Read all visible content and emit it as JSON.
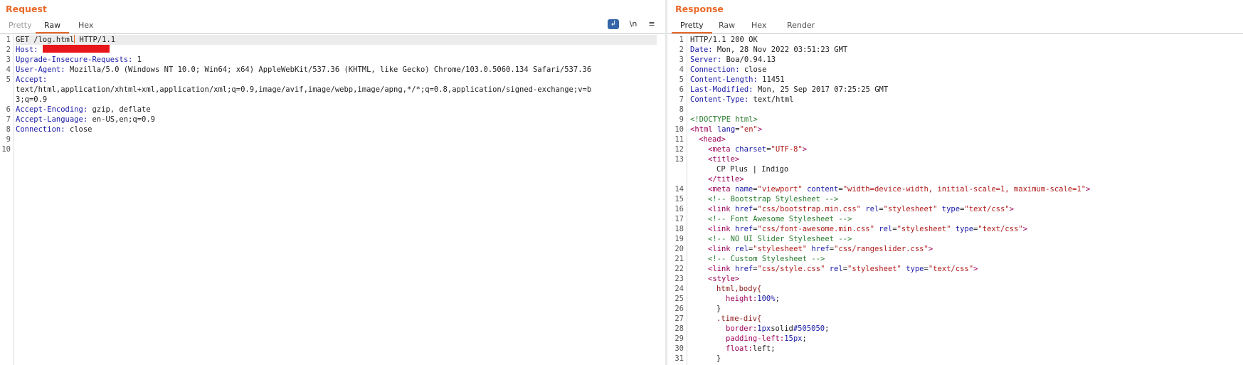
{
  "request": {
    "title": "Request",
    "tabs": [
      "Pretty",
      "Raw",
      "Hex"
    ],
    "active_tab": "Raw",
    "toolbar": {
      "wrap_icon": "wrap-lines-icon",
      "newline_label": "\\n",
      "menu_label": "≡"
    },
    "line_numbers": [
      "1",
      "2",
      "3",
      "4",
      "5",
      "",
      "",
      "6",
      "7",
      "8",
      "9",
      "10"
    ],
    "lines": {
      "l1_a": "GET /log.html",
      "l1_b": " HTTP/1.1",
      "l2_key": "Host:",
      "l3_key": "Upgrade-Insecure-Requests:",
      "l3_val": " 1",
      "l4_key": "User-Agent:",
      "l4_val": " Mozilla/5.0 (Windows NT 10.0; Win64; x64) AppleWebKit/537.36 (KHTML, like Gecko) Chrome/103.0.5060.134 Safari/537.36",
      "l5_key": "Accept:",
      "l5_val1": "text/html,application/xhtml+xml,application/xml;q=0.9,image/avif,image/webp,image/apng,*/*;q=0.8,application/signed-exchange;v=b",
      "l5_val2": "3;q=0.9",
      "l6_key": "Accept-Encoding:",
      "l6_val": " gzip, deflate",
      "l7_key": "Accept-Language:",
      "l7_val": " en-US,en;q=0.9",
      "l8_key": "Connection:",
      "l8_val": " close"
    }
  },
  "response": {
    "title": "Response",
    "tabs": [
      "Pretty",
      "Raw",
      "Hex",
      "Render"
    ],
    "active_tab": "Pretty",
    "line_numbers": [
      "1",
      "2",
      "3",
      "4",
      "5",
      "6",
      "7",
      "8",
      "9",
      "10",
      "11",
      "12",
      "13",
      "",
      "",
      "14",
      "15",
      "16",
      "17",
      "18",
      "19",
      "20",
      "21",
      "22",
      "23",
      "24",
      "25",
      "26",
      "27",
      "28",
      "29",
      "30",
      "31"
    ],
    "headers": {
      "status": "HTTP/1.1 200 OK",
      "date_key": "Date:",
      "date_val": " Mon, 28 Nov 2022 03:51:23 GMT",
      "server_key": "Server:",
      "server_val": " Boa/0.94.13",
      "conn_key": "Connection:",
      "conn_val": " close",
      "cl_key": "Content-Length:",
      "cl_val": " 11451",
      "lm_key": "Last-Modified:",
      "lm_val": " Mon, 25 Sep 2017 07:25:25 GMT",
      "ct_key": "Content-Type:",
      "ct_val": " text/html"
    },
    "body": {
      "doctype": "<!DOCTYPE html>",
      "html_open": "<html",
      "lang_attr": "lang",
      "lang_val": "\"en\"",
      "gt": ">",
      "head_open": "<head>",
      "meta_open": "<meta",
      "charset_attr": "charset",
      "charset_val": "\"UTF-8\"",
      "title_open": "<title>",
      "title_text": "CP Plus | Indigo",
      "title_close": "</title>",
      "viewport_name_attr": "name",
      "viewport_name_val": "\"viewport\"",
      "content_attr": "content",
      "content_val": "\"width=device-width, initial-scale=1, maximum-scale=1\"",
      "cmt_bootstrap": "<!-- Bootstrap Stylesheet -->",
      "link_open": "<link",
      "href_attr": "href",
      "rel_attr": "rel",
      "type_attr": "type",
      "bootstrap_href": "\"css/bootstrap.min.css\"",
      "stylesheet_val": "\"stylesheet\"",
      "textcss_val": "\"text/css\"",
      "cmt_fa": "<!-- Font Awesome Stylesheet -->",
      "fa_href": "\"css/font-awesome.min.css\"",
      "cmt_slider": "<!-- NO UI Slider Stylesheet -->",
      "slider_href": "\"css/rangeslider.css\"",
      "cmt_custom": "<!-- Custom Stylesheet -->",
      "style_href": "\"css/style.css\"",
      "style_open": "<style>",
      "sel_html_body": "html,body{",
      "prop_height": "height:",
      "val_height": "100%",
      "semicolon": ";",
      "close_brace": "}",
      "sel_time_div": ".time-div{",
      "prop_border": "border:",
      "val_border_a": "1px",
      "val_border_b": "solid",
      "val_border_c": "#505050",
      "prop_padding": "padding-left:",
      "val_padding": "15px",
      "prop_float": "float:",
      "val_float": "left;"
    }
  }
}
